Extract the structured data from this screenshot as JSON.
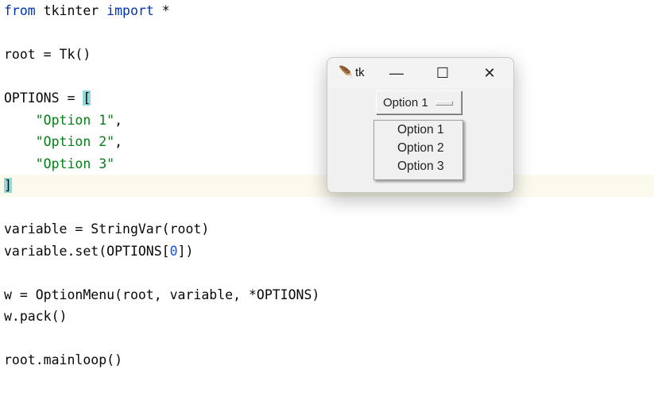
{
  "code": [
    [
      {
        "t": "from",
        "c": "kw"
      },
      {
        "t": " tkinter "
      },
      {
        "t": "import",
        "c": "kw"
      },
      {
        "t": " *"
      }
    ],
    [],
    [
      {
        "t": "root = Tk()"
      }
    ],
    [],
    [
      {
        "t": "OPTIONS = "
      },
      {
        "t": "[",
        "c": "brace"
      }
    ],
    [
      {
        "t": "    "
      },
      {
        "t": "\"Option 1\"",
        "c": "str"
      },
      {
        "t": ","
      }
    ],
    [
      {
        "t": "    "
      },
      {
        "t": "\"Option 2\"",
        "c": "str"
      },
      {
        "t": ","
      }
    ],
    [
      {
        "t": "    "
      },
      {
        "t": "\"Option 3\"",
        "c": "str"
      }
    ],
    [
      {
        "t": "]",
        "c": "brace"
      }
    ],
    [],
    [
      {
        "t": "variable = StringVar(root)"
      }
    ],
    [
      {
        "t": "variable.set(OPTIONS["
      },
      {
        "t": "0",
        "c": "num"
      },
      {
        "t": "])"
      }
    ],
    [],
    [
      {
        "t": "w = OptionMenu(root, variable, *OPTIONS)"
      }
    ],
    [
      {
        "t": "w.pack()"
      }
    ],
    [],
    [
      {
        "t": "root.mainloop()"
      }
    ]
  ],
  "current_line": 8,
  "window": {
    "title": "tk",
    "icon": "feather-icon",
    "minimize": "—",
    "maximize": "☐",
    "close": "✕",
    "option_menu": {
      "selected": "Option 1",
      "options": [
        "Option 1",
        "Option 2",
        "Option 3"
      ]
    }
  }
}
